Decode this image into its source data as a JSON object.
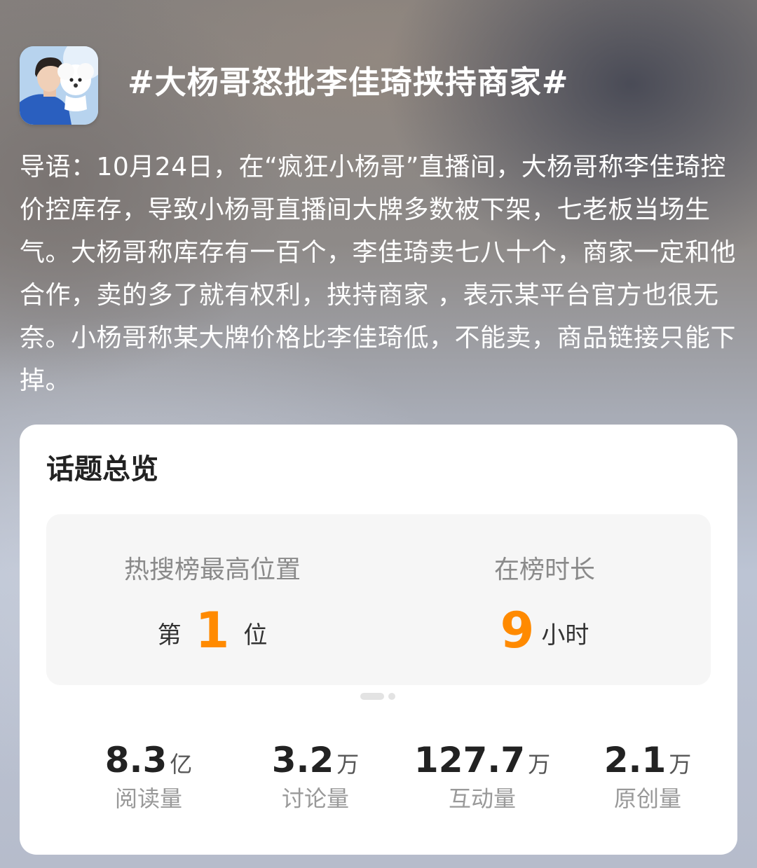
{
  "topic": {
    "title": "#大杨哥怒批李佳琦挟持商家#",
    "avatar_icon": "avatar-photo"
  },
  "intro": {
    "text": "导语：10月24日，在“疯狂小杨哥”直播间，大杨哥称李佳琦控价控库存，导致小杨哥直播间大牌多数被下架，七老板当场生气。大杨哥称库存有一百个，李佳琦卖七八十个，商家一定和他合作，卖的多了就有权利，挟持商家 ，表示某平台官方也很无奈。小杨哥称某大牌价格比李佳琦低，不能卖，商品链接只能下掉。"
  },
  "overview": {
    "title": "话题总览",
    "rank": {
      "label": "热搜榜最高位置",
      "prefix": "第",
      "value": "1",
      "suffix": "位"
    },
    "duration": {
      "label": "在榜时长",
      "value": "9",
      "suffix": "小时"
    },
    "pager": {
      "count": 2,
      "active": 0
    },
    "metrics": [
      {
        "value": "8.3",
        "unit": "亿",
        "name": "阅读量"
      },
      {
        "value": "3.2",
        "unit": "万",
        "name": "讨论量"
      },
      {
        "value": "127.7",
        "unit": "万",
        "name": "互动量"
      },
      {
        "value": "2.1",
        "unit": "万",
        "name": "原创量"
      }
    ]
  },
  "colors": {
    "accent": "#ff8a00",
    "card_bg": "#ffffff",
    "panel_bg": "#f6f6f6"
  }
}
